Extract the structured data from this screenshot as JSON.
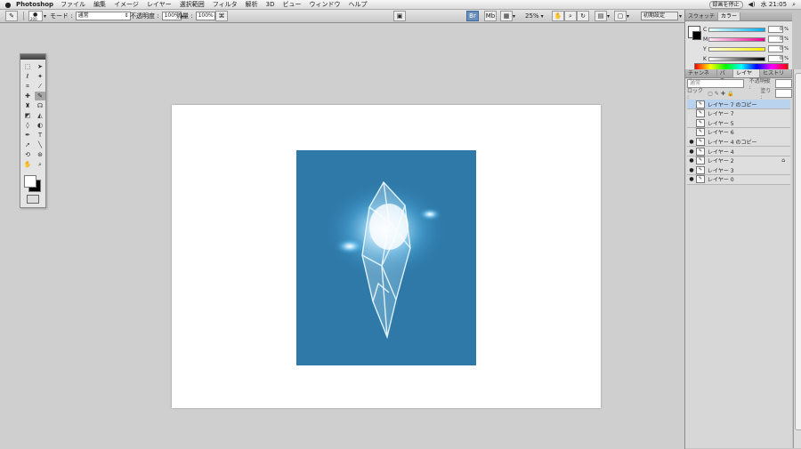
{
  "menubar": {
    "apple": "",
    "app": "Photoshop",
    "menus": [
      "ファイル",
      "編集",
      "イメージ",
      "レイヤー",
      "選択範囲",
      "フィルタ",
      "解析",
      "3D",
      "ビュー",
      "ウィンドウ",
      "ヘルプ"
    ],
    "recording": "録画を停止",
    "clock": "水 21:05"
  },
  "options": {
    "mode_label": "モード :",
    "mode_value": "通常",
    "opacity_label": "不透明度 :",
    "opacity_value": "100%",
    "flow_label": "流量 :",
    "flow_value": "100%",
    "brush_size": "200",
    "zoom": "25%",
    "workspace": "初期設定"
  },
  "color_panel": {
    "tabs": [
      "スウォッチ",
      "カラー"
    ],
    "rows": [
      {
        "label": "C",
        "value": "0",
        "unit": "%",
        "gradient": "#e8ffff,#00aeef"
      },
      {
        "label": "M",
        "value": "0",
        "unit": "%",
        "gradient": "#ffe8f4,#ec008c"
      },
      {
        "label": "Y",
        "value": "0",
        "unit": "%",
        "gradient": "#ffffe8,#fff200"
      },
      {
        "label": "K",
        "value": "0",
        "unit": "%",
        "gradient": "#ffffff,#000000"
      }
    ]
  },
  "layers_panel": {
    "tabs": [
      "チャンネル",
      "パス",
      "レイヤー",
      "ヒストリー"
    ],
    "blend": "通常",
    "opacity_label": "不透明度 :",
    "lock_label": "ロック :",
    "fill_label": "塗り :",
    "layers": [
      {
        "name": "レイヤー 7 のコピー",
        "visible": false,
        "selected": true,
        "locked": false
      },
      {
        "name": "レイヤー 7",
        "visible": false,
        "selected": false,
        "locked": false
      },
      {
        "name": "レイヤー 5",
        "visible": false,
        "selected": false,
        "locked": false
      },
      {
        "name": "レイヤー 6",
        "visible": false,
        "selected": false,
        "locked": false
      },
      {
        "name": "レイヤー 4 のコピー",
        "visible": true,
        "selected": false,
        "locked": false
      },
      {
        "name": "レイヤー 4",
        "visible": true,
        "selected": false,
        "locked": false
      },
      {
        "name": "レイヤー 2",
        "visible": true,
        "selected": false,
        "locked": true
      },
      {
        "name": "レイヤー 3",
        "visible": true,
        "selected": false,
        "locked": false
      },
      {
        "name": "レイヤー 0",
        "visible": true,
        "selected": false,
        "locked": false
      }
    ]
  },
  "canvas": {
    "artwork_bg": "#2e79a8"
  }
}
